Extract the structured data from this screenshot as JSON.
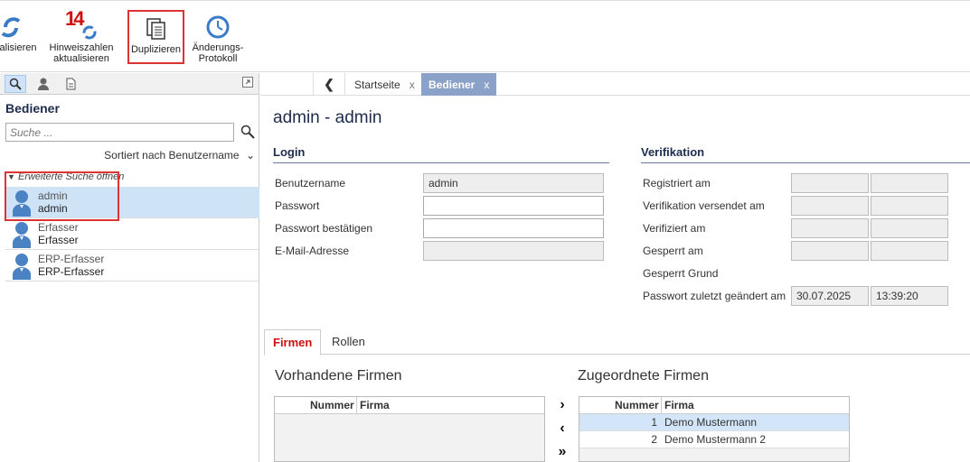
{
  "toolbar": {
    "refresh_label": "alisieren",
    "hints_label_1": "Hinweiszahlen",
    "hints_label_2": "aktualisieren",
    "hints_badge": "14",
    "duplicate_label": "Duplizieren",
    "changelog_label_1": "Änderungs-",
    "changelog_label_2": "Protokoll"
  },
  "left": {
    "title": "Bediener",
    "search_placeholder": "Suche ...",
    "sort_label": "Sortiert nach Benutzername",
    "extended_search": "Erweiterte Suche öffnen",
    "users": [
      {
        "line1": "admin",
        "line2": "admin"
      },
      {
        "line1": "Erfasser",
        "line2": "Erfasser"
      },
      {
        "line1": "ERP-Erfasser",
        "line2": "ERP-Erfasser"
      }
    ]
  },
  "tabs": {
    "back": "❮",
    "start": "Startseite",
    "start_close": "x",
    "active": "Bediener",
    "active_close": "x"
  },
  "main": {
    "title": "admin - admin",
    "login": {
      "heading": "Login",
      "username_label": "Benutzername",
      "username_value": "admin",
      "password_label": "Passwort",
      "password_confirm_label": "Passwort bestätigen",
      "email_label": "E-Mail-Adresse"
    },
    "verification": {
      "heading": "Verifikation",
      "registered": "Registriert am",
      "sent": "Verifikation versendet am",
      "verified": "Verifiziert am",
      "locked": "Gesperrt am",
      "locked_reason": "Gesperrt Grund",
      "pw_changed": "Passwort zuletzt geändert am",
      "pw_changed_date": "30.07.2025",
      "pw_changed_time": "13:39:20"
    },
    "subtabs": [
      "Firmen",
      "Rollen"
    ],
    "available": {
      "heading": "Vorhandene Firmen",
      "col_number": "Nummer",
      "col_company": "Firma"
    },
    "assigned": {
      "heading": "Zugeordnete Firmen",
      "col_number": "Nummer",
      "col_company": "Firma",
      "rows": [
        {
          "number": "1",
          "company": "Demo Mustermann"
        },
        {
          "number": "2",
          "company": "Demo Mustermann 2"
        }
      ]
    },
    "move_buttons": {
      "add": "›",
      "remove": "‹",
      "add_all": "»"
    }
  }
}
